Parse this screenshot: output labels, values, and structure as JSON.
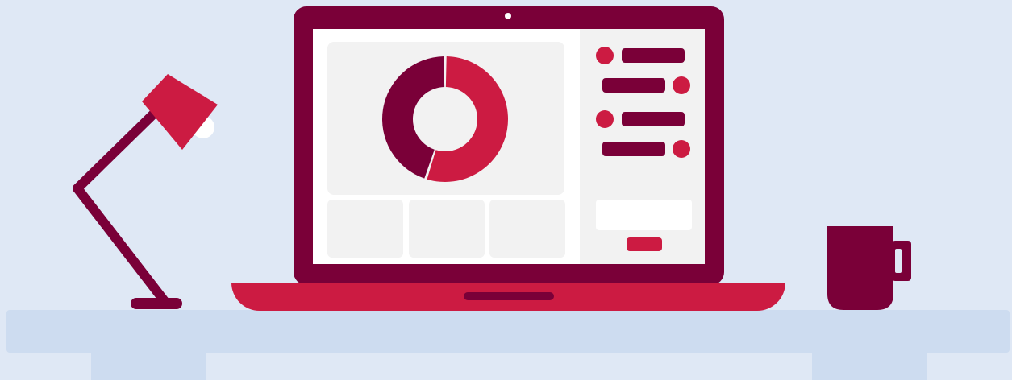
{
  "colors": {
    "background": "#dfe8f5",
    "desk": "#cddcf0",
    "primary_dark": "#7a0038",
    "primary_accent": "#cc1b42",
    "screen_white": "#ffffff",
    "panel_gray": "#f2f2f2"
  },
  "scene": {
    "objects": [
      "desk-lamp-icon",
      "laptop-icon",
      "donut-chart-icon",
      "coffee-mug-icon"
    ]
  },
  "chart_data": {
    "type": "pie",
    "values": [
      45,
      55
    ],
    "colors": [
      "#7a0038",
      "#cc1b42"
    ]
  }
}
